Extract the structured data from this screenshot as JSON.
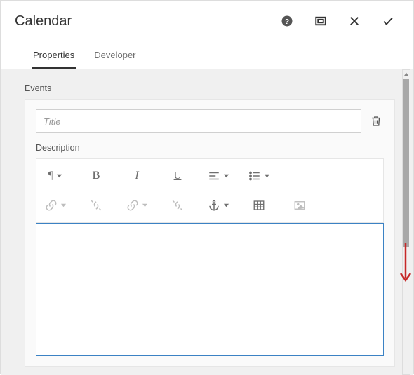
{
  "header": {
    "title": "Calendar"
  },
  "tabs": {
    "properties": "Properties",
    "developer": "Developer",
    "active_index": 0
  },
  "events": {
    "section_label": "Events",
    "title_placeholder": "Title",
    "title_value": "",
    "description_label": "Description",
    "description_value": ""
  },
  "icons": {
    "help": "help-icon",
    "fullscreen": "fullscreen-icon",
    "close": "close-icon",
    "confirm": "check-icon",
    "trash": "trash-icon",
    "pilcrow": "¶",
    "bold": "B",
    "italic": "I",
    "underline": "U"
  }
}
